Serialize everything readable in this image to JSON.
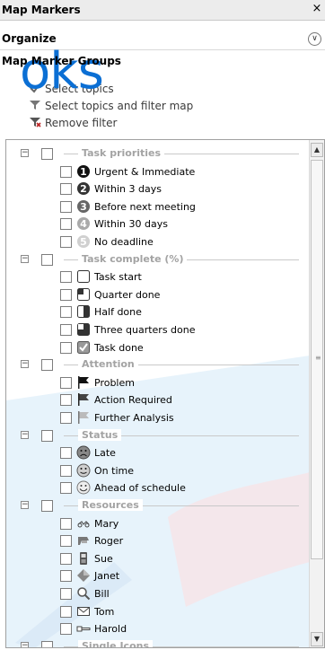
{
  "panel": {
    "title": "Map Markers",
    "close_symbol": "×",
    "organize_label": "Organize",
    "organize_chevron": "∨",
    "groups_title": "Map Marker Groups",
    "watermark_text": "oks",
    "actions": [
      {
        "label": "Select topics",
        "icon": "select-icon"
      },
      {
        "label": "Select topics and filter map",
        "icon": "filter-icon"
      },
      {
        "label": "Remove filter",
        "icon": "remove-filter-icon"
      }
    ]
  },
  "groups": [
    {
      "title": "Task priorities",
      "expander": "−",
      "items": [
        {
          "label": "Urgent & Immediate",
          "icon": "priority-1-icon",
          "glyph": "1"
        },
        {
          "label": "Within 3 days",
          "icon": "priority-2-icon",
          "glyph": "2"
        },
        {
          "label": "Before next meeting",
          "icon": "priority-3-icon",
          "glyph": "3"
        },
        {
          "label": "Within 30 days",
          "icon": "priority-4-icon",
          "glyph": "4"
        },
        {
          "label": "No deadline",
          "icon": "priority-5-icon",
          "glyph": "5"
        }
      ]
    },
    {
      "title": "Task complete (%)",
      "expander": "−",
      "items": [
        {
          "label": "Task start",
          "icon": "progress-0-icon"
        },
        {
          "label": "Quarter done",
          "icon": "progress-25-icon"
        },
        {
          "label": "Half done",
          "icon": "progress-50-icon"
        },
        {
          "label": "Three quarters done",
          "icon": "progress-75-icon"
        },
        {
          "label": "Task done",
          "icon": "progress-100-icon"
        }
      ]
    },
    {
      "title": "Attention",
      "expander": "−",
      "items": [
        {
          "label": "Problem",
          "icon": "flag-black-icon"
        },
        {
          "label": "Action Required",
          "icon": "flag-dark-icon"
        },
        {
          "label": "Further Analysis",
          "icon": "flag-light-icon"
        }
      ]
    },
    {
      "title": "Status",
      "expander": "−",
      "items": [
        {
          "label": "Late",
          "icon": "face-sad-icon"
        },
        {
          "label": "On time",
          "icon": "face-neutral-icon"
        },
        {
          "label": "Ahead of schedule",
          "icon": "face-happy-icon"
        }
      ]
    },
    {
      "title": "Resources",
      "expander": "−",
      "items": [
        {
          "label": "Mary",
          "icon": "resource-mary-icon"
        },
        {
          "label": "Roger",
          "icon": "resource-roger-icon"
        },
        {
          "label": "Sue",
          "icon": "resource-sue-icon"
        },
        {
          "label": "Janet",
          "icon": "resource-janet-icon"
        },
        {
          "label": "Bill",
          "icon": "resource-bill-icon"
        },
        {
          "label": "Tom",
          "icon": "resource-tom-icon"
        },
        {
          "label": "Harold",
          "icon": "resource-harold-icon"
        }
      ]
    },
    {
      "title": "Single Icons",
      "expander": "−",
      "items": []
    }
  ],
  "scrollbar": {
    "up": "▲",
    "down": "▼",
    "grip": "≡"
  },
  "colors": {
    "watermark_blue": "#0b6fd4",
    "group_title_gray": "#a3a3a3"
  }
}
